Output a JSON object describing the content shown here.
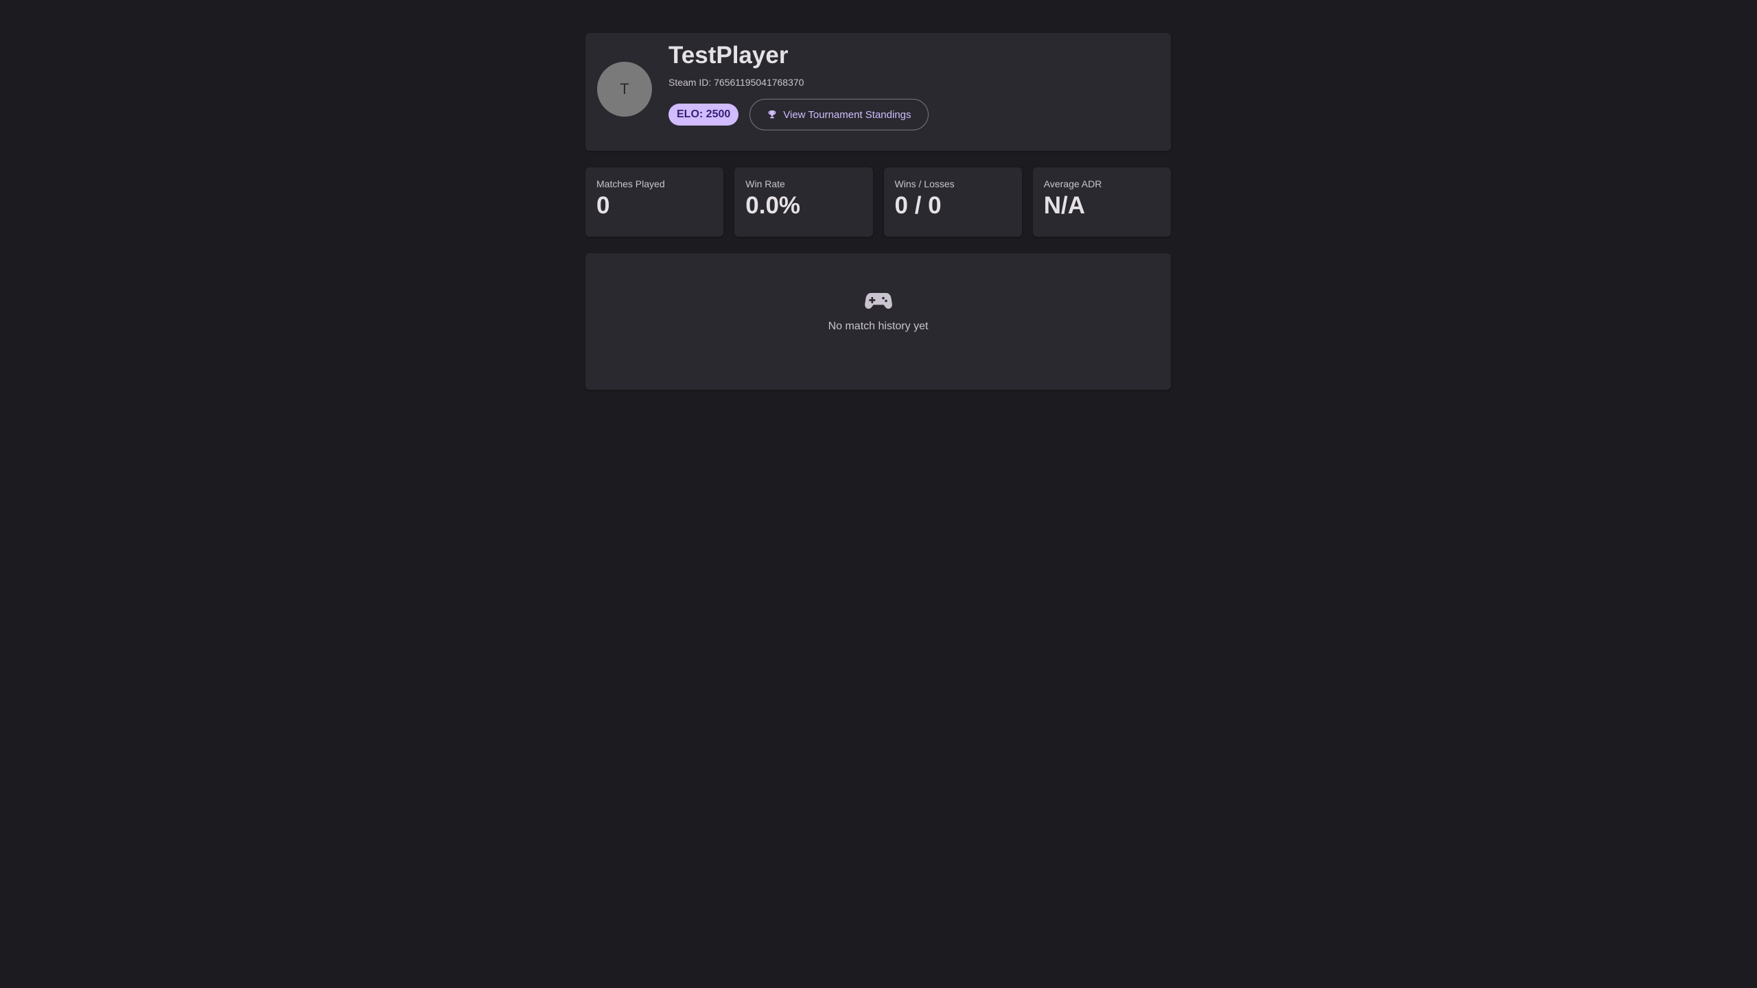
{
  "profile": {
    "avatar_initial": "T",
    "name": "TestPlayer",
    "steam_id": "Steam ID: 76561195041768370",
    "elo": "ELO: 2500",
    "standings_button": "View Tournament Standings",
    "standings_icon": "trophy-icon"
  },
  "stats": [
    {
      "label": "Matches Played",
      "value": "0"
    },
    {
      "label": "Win Rate",
      "value": "0.0%"
    },
    {
      "label": "Wins / Losses",
      "value": "0 / 0"
    },
    {
      "label": "Average ADR",
      "value": "N/A"
    }
  ],
  "history": {
    "icon": "gamepad-icon",
    "empty_text": "No match history yet"
  },
  "colors": {
    "background": "#1c1b1f",
    "card": "#2a292f",
    "accent": "#d0bcff",
    "accent_on": "#381e72"
  }
}
